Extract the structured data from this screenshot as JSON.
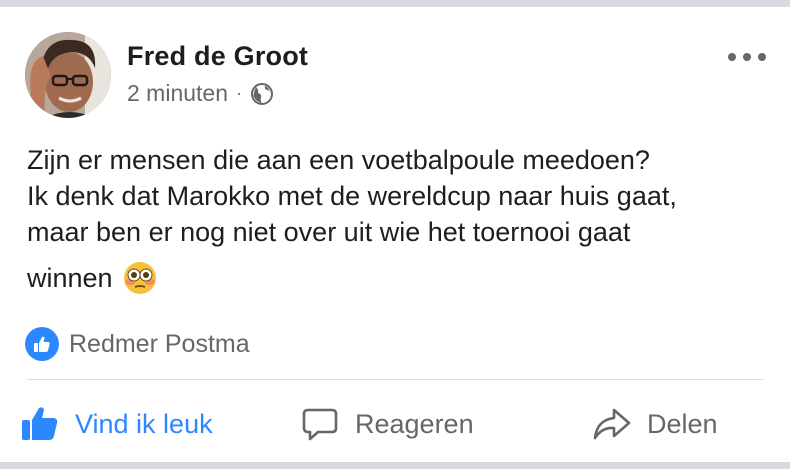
{
  "post": {
    "author": "Fred de Groot",
    "timestamp": "2 minuten",
    "separator": "·",
    "privacy_icon": "globe-icon",
    "more_icon": "more-options-icon",
    "text_lines": [
      "Zijn er mensen die aan een voetbalpoule meedoen?",
      "Ik denk dat Marokko met de wereldcup naar huis gaat,",
      "maar ben er nog niet over uit wie het toernooi gaat",
      "winnen"
    ],
    "emoji": "flushed-face-emoji"
  },
  "reactions": {
    "icon": "like-icon",
    "names": "Redmer Postma"
  },
  "actions": {
    "like_label": "Vind ik leuk",
    "comment_label": "Reageren",
    "share_label": "Delen"
  },
  "colors": {
    "accent": "#2d88ff",
    "text": "#1c1e21",
    "secondary": "#65676b",
    "divider": "#dddfe2"
  }
}
